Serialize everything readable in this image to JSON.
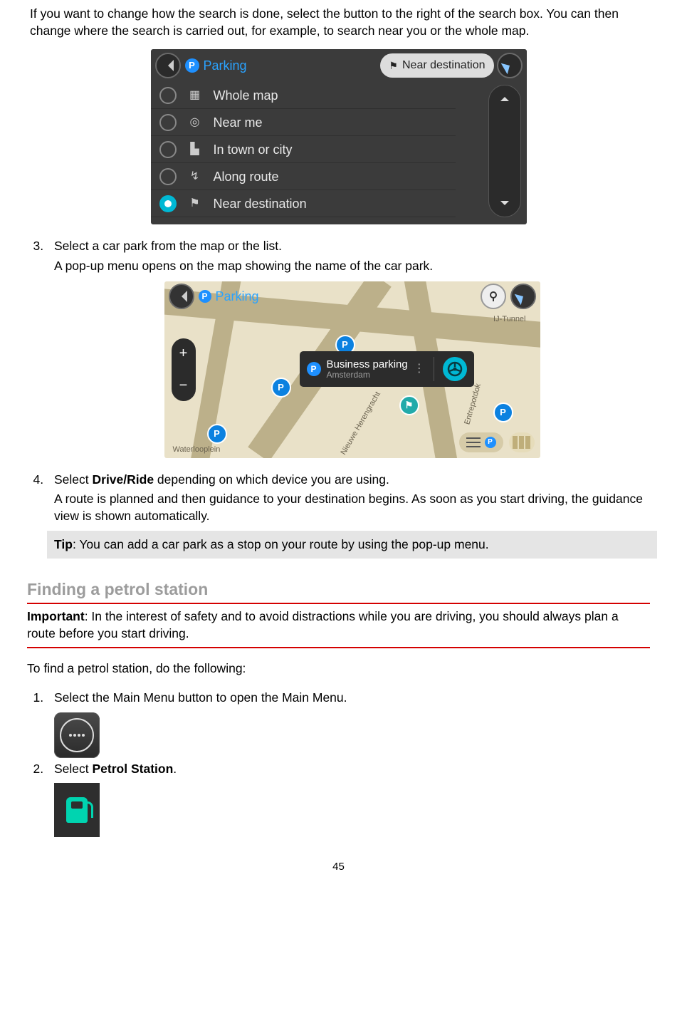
{
  "intro": "If you want to change how the search is done, select the button to the right of the search box. You can then change where the search is carried out, for example, to search near you or the whole map.",
  "fig1": {
    "parking_label": "Parking",
    "scope_pill": "Near destination",
    "options": {
      "whole_map": "Whole map",
      "near_me": "Near me",
      "in_town": "In town or city",
      "along_route": "Along route",
      "near_dest": "Near destination"
    }
  },
  "step3": {
    "line1": "Select a car park from the map or the list.",
    "line2": "A pop-up menu opens on the map showing the name of the car park."
  },
  "fig2": {
    "parking_label": "Parking",
    "popup_title": "Business parking",
    "popup_sub": "Amsterdam",
    "street1": "Nieuwe Herengracht",
    "street2": "Entrepotdok",
    "street3": "IJ-Tunnel",
    "street4": "Waterlooplein"
  },
  "step4": {
    "line1_a": "Select ",
    "line1_bold": "Drive/Ride",
    "line1_b": " depending on which device you are using.",
    "line2": "A route is planned and then guidance to your destination begins. As soon as you start driving, the guidance view is shown automatically.",
    "tip_label": "Tip",
    "tip_text": ": You can add a car park as a stop on your route by using the pop-up menu."
  },
  "section_title": "Finding a petrol station",
  "important": {
    "label": "Important",
    "text": ": In the interest of safety and to avoid distractions while you are driving, you should always plan a route before you start driving."
  },
  "petrol_intro": "To find a petrol station, do the following:",
  "pstep1": "Select the Main Menu button to open the Main Menu.",
  "pstep2_a": "Select ",
  "pstep2_bold": "Petrol Station",
  "pstep2_b": ".",
  "page_number": "45"
}
